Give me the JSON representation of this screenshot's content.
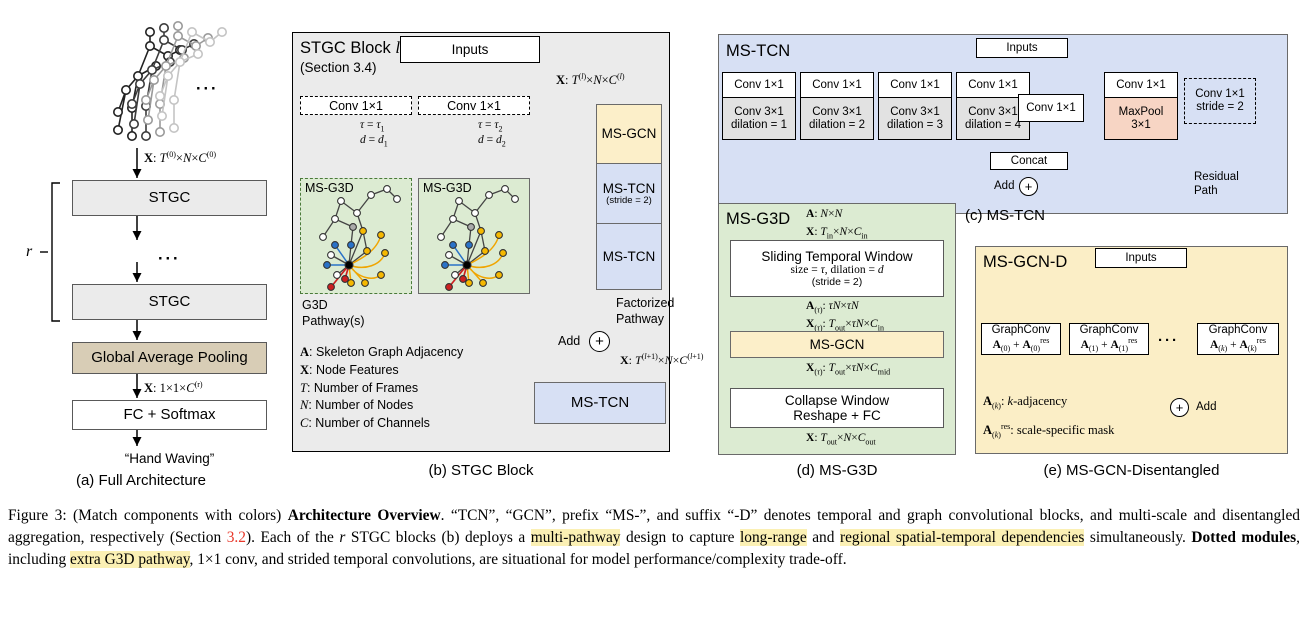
{
  "figure": {
    "number": "Figure 3:",
    "caption_parts": [
      {
        "t": "Figure 3: (Match components with colors) ",
        "s": "plain"
      },
      {
        "t": "Architecture Overview",
        "s": "bold"
      },
      {
        "t": ". “TCN”, “GCN”, prefix “MS-”, and suffix “-D” denotes temporal and graph convolutional blocks, and multi-scale and disentangled aggregation, respectively (Section ",
        "s": "plain"
      },
      {
        "t": "3.2",
        "s": "red"
      },
      {
        "t": "). Each of the ",
        "s": "plain"
      },
      {
        "t": "r",
        "s": "italic"
      },
      {
        "t": " STGC blocks (b) deploys a ",
        "s": "plain"
      },
      {
        "t": "multi-pathway",
        "s": "highlight"
      },
      {
        "t": " design to capture ",
        "s": "plain"
      },
      {
        "t": "long-range",
        "s": "highlight"
      },
      {
        "t": " and ",
        "s": "plain"
      },
      {
        "t": "regional spatial-temporal dependencies",
        "s": "highlight"
      },
      {
        "t": " simultaneously. ",
        "s": "plain"
      },
      {
        "t": "Dotted modules",
        "s": "bold"
      },
      {
        "t": ", including ",
        "s": "plain"
      },
      {
        "t": "extra G3D pathway",
        "s": "highlight"
      },
      {
        "t": ", 1×1 conv, and strided temporal convolutions, are situational for model performance/complexity trade-off.",
        "s": "plain"
      }
    ]
  },
  "colors": {
    "grey_panel": "#ebebeb",
    "tan": "#d8cdb6",
    "yellow_gcn": "#fcefc9",
    "blue_tcn": "#d7e0f4",
    "green_g3d": "#dcebd2",
    "salmon_maxpool": "#f7d5c4",
    "highlight": "#fbf0b4",
    "red_link": "#e8382b"
  },
  "panel_a": {
    "sublabel": "(a) Full Architecture",
    "skeleton_icon": "skeleton-sequence",
    "ellipsis": "···",
    "tensor_in": "X: T(0)×N×C(0)",
    "stgc_top": "STGC",
    "stgc_dots": "···",
    "stgc_bottom": "STGC",
    "repeat_label": "r",
    "gap": "Global Average Pooling",
    "tensor_mid": "X: 1×1×C(r)",
    "fc": "FC + Softmax",
    "output": "“Hand Waving”"
  },
  "panel_b": {
    "sublabel": "(b) STGC Block",
    "title": "STGC Block",
    "title_italic": "l",
    "section": "(Section 3.4)",
    "inputs": "Inputs",
    "tensor_in": "X: T(l)×N×C(l)",
    "conv1": "Conv 1×1",
    "conv2": "Conv 1×1",
    "tau1": "τ = τ1",
    "d1": "d = d1",
    "tau2": "τ = τ2",
    "d2": "d = d2",
    "g3d_1": "MS-G3D",
    "g3d_2": "MS-G3D",
    "g3d_pathway_label": [
      "G3D",
      "Pathway(s)"
    ],
    "msgcn": "MS-GCN",
    "mstcn_stride": "MS-TCN",
    "mstcn_stride_note": "(stride = 2)",
    "mstcn": "MS-TCN",
    "factorized_label": [
      "Factorized",
      "Pathway"
    ],
    "add_label": "Add",
    "add_symbol": "+",
    "tensor_out": "X: T(l+1)×N×C(l+1)",
    "mstcn_bottom": "MS-TCN",
    "legend": [
      {
        "sym": "A",
        "desc": ": Skeleton Graph Adjacency"
      },
      {
        "sym": "X",
        "desc": ": Node Features"
      },
      {
        "sym": "T",
        "desc": ": Number of Frames"
      },
      {
        "sym": "N",
        "desc": ": Number of Nodes"
      },
      {
        "sym": "C",
        "desc": ": Number of Channels"
      }
    ]
  },
  "panel_c": {
    "sublabel": "(c) MS-TCN",
    "title": "MS-TCN",
    "inputs": "Inputs",
    "branches": [
      {
        "top": "Conv 1×1",
        "bot1": "Conv 3×1",
        "bot2": "dilation = 1"
      },
      {
        "top": "Conv 1×1",
        "bot1": "Conv 3×1",
        "bot2": "dilation = 2"
      },
      {
        "top": "Conv 1×1",
        "bot1": "Conv 3×1",
        "bot2": "dilation = 3"
      },
      {
        "top": "Conv 1×1",
        "bot1": "Conv 3×1",
        "bot2": "dilation = 4"
      }
    ],
    "plain_conv": "Conv 1×1",
    "maxpool_top": "Conv 1×1",
    "maxpool_b1": "MaxPool",
    "maxpool_b2": "3×1",
    "residual_conv_1": "Conv 1×1",
    "residual_conv_2": "stride = 2",
    "concat": "Concat",
    "add_label": "Add",
    "add_symbol": "+",
    "residual_label": [
      "Residual",
      "Path"
    ]
  },
  "panel_d": {
    "sublabel": "(d) MS-G3D",
    "title": "MS-G3D",
    "in_A": "A: N×N",
    "in_X": "X: Tin×N×Cin",
    "sliding_1": "Sliding Temporal Window",
    "sliding_2": "size = τ, dilation = d",
    "sliding_3": "(stride = 2)",
    "mid_A": "A(τ): τN×τN",
    "mid_X": "X(τ): Tout×τN×Cin",
    "msgcn": "MS-GCN",
    "post_X": "X(τ): Tout×τN×Cmid",
    "collapse_1": "Collapse Window",
    "collapse_2": "Reshape + FC",
    "out_X": "X: Tout×N×Cout"
  },
  "panel_e": {
    "sublabel": "(e) MS-GCN-Disentangled",
    "title": "MS-GCN-D",
    "inputs": "Inputs",
    "graphconvs": [
      {
        "l1": "GraphConv",
        "l2": "A(0) + A(0)res"
      },
      {
        "l1": "GraphConv",
        "l2": "A(1) + A(1)res"
      },
      {
        "l1": "GraphConv",
        "l2": "A(k) + A(k)res"
      }
    ],
    "ellipsis": "···",
    "add_label": "Add",
    "add_symbol": "+",
    "legend": [
      "A(k): k-adjacency",
      "A(k)res: scale-specific mask"
    ]
  }
}
